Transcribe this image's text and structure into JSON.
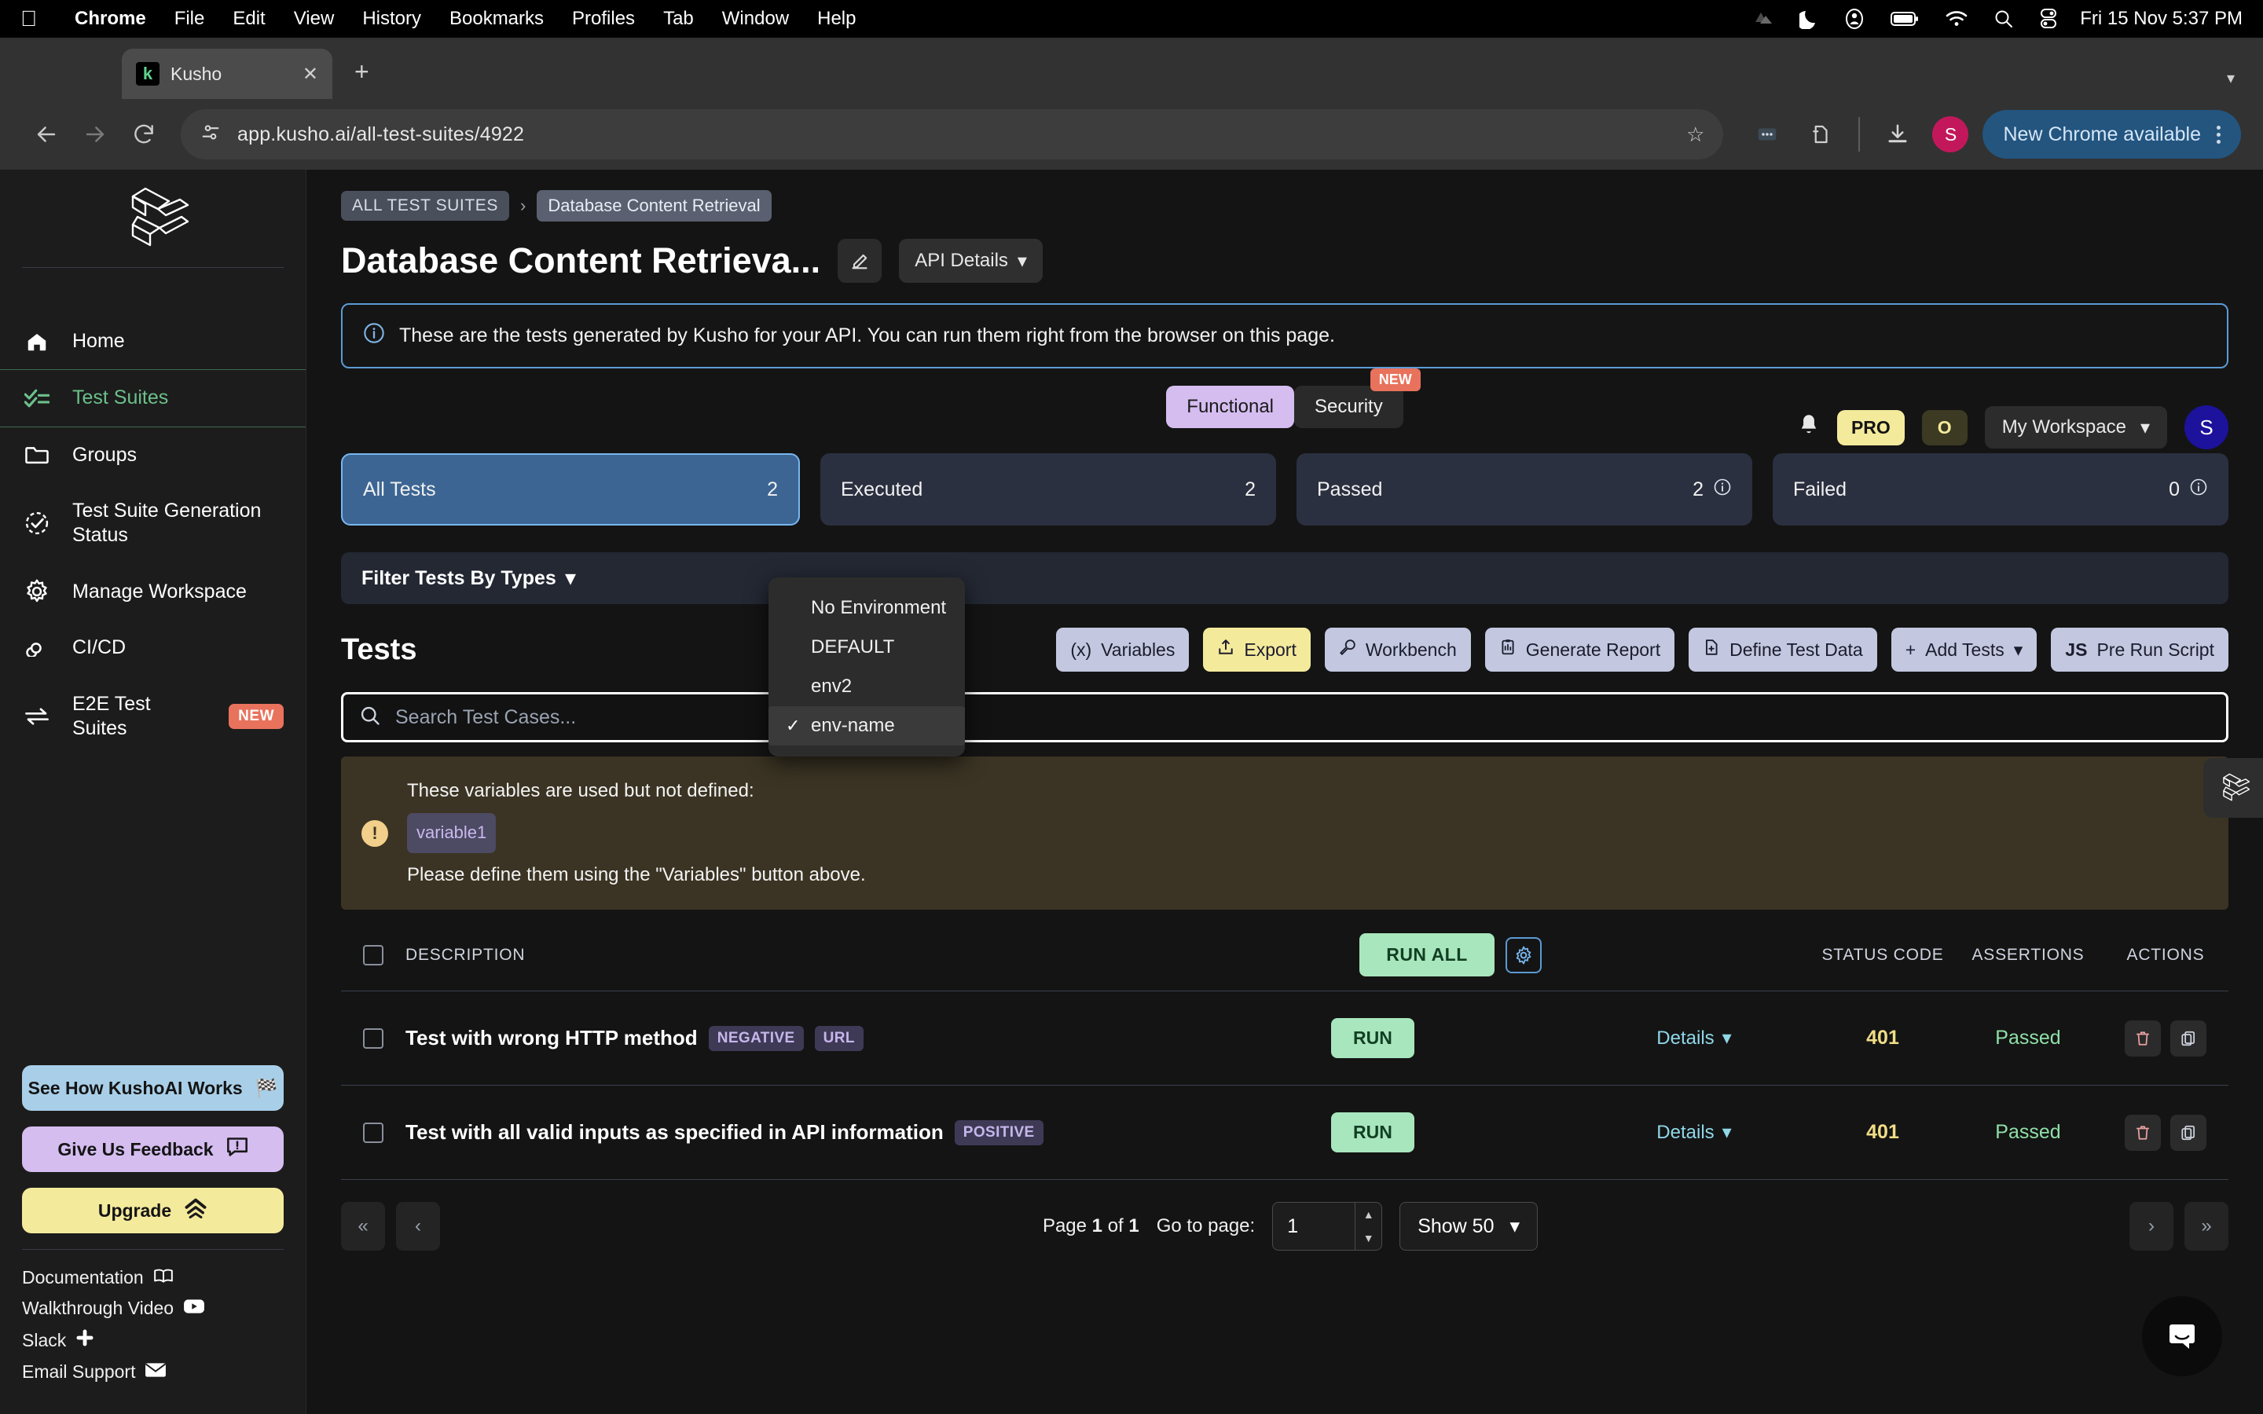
{
  "os_menubar": {
    "apple_icon": "apple-icon",
    "items": [
      "Chrome",
      "File",
      "Edit",
      "View",
      "History",
      "Bookmarks",
      "Profiles",
      "Tab",
      "Window",
      "Help"
    ],
    "status_icons": [
      "cloud-icon",
      "moon-icon",
      "user-circle-icon",
      "battery-icon",
      "wifi-icon",
      "search-icon",
      "control-center-icon"
    ],
    "clock": "Fri 15 Nov  5:37 PM"
  },
  "browser": {
    "tab": {
      "title": "Kusho",
      "favicon_letter": "k",
      "close_icon": "close-icon"
    },
    "new_tab_icon": "plus-icon",
    "tab_list_chevron": "chevron-down-icon",
    "back_icon": "arrow-left-icon",
    "forward_icon": "arrow-right-icon",
    "reload_icon": "reload-icon",
    "site_info_icon": "tune-icon",
    "url": "app.kusho.ai/all-test-suites/4922",
    "bookmark_icon": "star-icon",
    "extension_icons": [
      "more-icon",
      "extensions-icon"
    ],
    "download_icon": "download-icon",
    "profile_initial": "S",
    "update_pill": "New Chrome available",
    "menu_icon": "kebab-menu-icon"
  },
  "sidebar": {
    "logo": "kusho-logo",
    "items": [
      {
        "label": "Home",
        "icon": "home-icon",
        "active": false
      },
      {
        "label": "Test Suites",
        "icon": "checklist-icon",
        "active": true
      },
      {
        "label": "Groups",
        "icon": "folder-icon",
        "active": false
      },
      {
        "label": "Test Suite Generation Status",
        "icon": "status-check-icon",
        "active": false
      },
      {
        "label": "Manage Workspace",
        "icon": "gear-icon",
        "active": false
      },
      {
        "label": "CI/CD",
        "icon": "infinity-icon",
        "active": false
      },
      {
        "label": "E2E Test Suites",
        "icon": "swap-icon",
        "active": false,
        "badge": "NEW"
      }
    ],
    "buttons": [
      {
        "label": "See How KushoAI Works",
        "icon": "checkered-flag-icon",
        "color": "#a9cfe8"
      },
      {
        "label": "Give Us Feedback",
        "icon": "feedback-icon",
        "color": "#d5bdf0"
      },
      {
        "label": "Upgrade",
        "icon": "chevrons-up-icon",
        "color": "#f4ea9c"
      }
    ],
    "links": [
      {
        "label": "Documentation",
        "icon": "book-icon"
      },
      {
        "label": "Walkthrough Video",
        "icon": "youtube-icon"
      },
      {
        "label": "Slack",
        "icon": "slack-icon"
      },
      {
        "label": "Email Support",
        "icon": "envelope-icon"
      }
    ]
  },
  "header": {
    "breadcrumb_root": "ALL TEST SUITES",
    "breadcrumb_sep": "›",
    "breadcrumb_current": "Database Content Retrieval",
    "title": "Database Content Retrieva...",
    "edit_icon": "edit-icon",
    "api_details_label": "API Details",
    "api_details_chevron": "chevron-down-icon",
    "bell_icon": "bell-icon",
    "pro_badge": "PRO",
    "org_badge": "O",
    "workspace_label": "My Workspace",
    "workspace_chevron": "chevron-down-icon",
    "avatar_initial": "S"
  },
  "info_banner": {
    "icon": "info-icon",
    "text": "These are the tests generated by Kusho for your API. You can run them right from the browser on this page."
  },
  "view_tabs": {
    "functional": "Functional",
    "security": "Security",
    "security_badge": "NEW"
  },
  "stats": [
    {
      "label": "All Tests",
      "value": "2",
      "selected": true,
      "info": false
    },
    {
      "label": "Executed",
      "value": "2",
      "selected": false,
      "info": false
    },
    {
      "label": "Passed",
      "value": "2",
      "selected": false,
      "info": true
    },
    {
      "label": "Failed",
      "value": "0",
      "selected": false,
      "info": true
    }
  ],
  "filter": {
    "label": "Filter Tests By Types",
    "chevron": "chevron-down-icon"
  },
  "env_dropdown": {
    "items": [
      {
        "label": "No Environment",
        "checked": false
      },
      {
        "label": "DEFAULT",
        "checked": false
      },
      {
        "label": "env2",
        "checked": false
      },
      {
        "label": "env-name",
        "checked": true
      }
    ],
    "check_glyph": "✓"
  },
  "tests_section": {
    "heading": "Tests",
    "toolbar": [
      {
        "label": "Variables",
        "icon": "variable-icon",
        "highlight": false
      },
      {
        "label": "Export",
        "icon": "export-icon",
        "highlight": true
      },
      {
        "label": "Workbench",
        "icon": "wrench-icon",
        "highlight": false
      },
      {
        "label": "Generate Report",
        "icon": "report-icon",
        "highlight": false
      },
      {
        "label": "Define Test Data",
        "icon": "file-plus-icon",
        "highlight": false
      },
      {
        "label": "Add Tests",
        "icon": "plus-icon",
        "highlight": false,
        "chevron": "chevron-down-icon"
      },
      {
        "label": "Pre Run Script",
        "icon": "js-icon",
        "highlight": false
      }
    ]
  },
  "search": {
    "icon": "search-icon",
    "placeholder": "Search Test Cases...",
    "value": ""
  },
  "warning": {
    "icon": "warning-icon",
    "line1": "These variables are used but not defined:",
    "chips": [
      "variable1"
    ],
    "line2": "Please define them using the \"Variables\" button above."
  },
  "table": {
    "headers": {
      "description": "DESCRIPTION",
      "run_all": "RUN ALL",
      "settings_icon": "gear-icon",
      "status_code": "STATUS CODE",
      "assertions": "ASSERTIONS",
      "actions": "ACTIONS"
    },
    "rows": [
      {
        "description": "Test with wrong HTTP method",
        "tags": [
          "NEGATIVE",
          "URL"
        ],
        "run_label": "RUN",
        "details_label": "Details",
        "details_chevron": "chevron-down-icon",
        "status_code": "401",
        "assertions": "Passed",
        "actions": [
          "delete-icon",
          "copy-icon"
        ]
      },
      {
        "description": "Test with all valid inputs as specified in API information",
        "tags": [
          "POSITIVE"
        ],
        "run_label": "RUN",
        "details_label": "Details",
        "details_chevron": "chevron-down-icon",
        "status_code": "401",
        "assertions": "Passed",
        "actions": [
          "delete-icon",
          "copy-icon"
        ]
      }
    ]
  },
  "pagination": {
    "first_icon": "«",
    "prev_icon": "‹",
    "page_text_prefix": "Page",
    "page_current": "1",
    "page_of": "of",
    "page_total": "1",
    "goto_label": "Go to page:",
    "goto_value": "1",
    "show_label": "Show 50",
    "show_chevron": "chevron-down-icon",
    "next_icon": "›",
    "last_icon": "»"
  },
  "floating": {
    "edge_logo": "kusho-logo",
    "chat_icon": "intercom-chat-icon"
  }
}
